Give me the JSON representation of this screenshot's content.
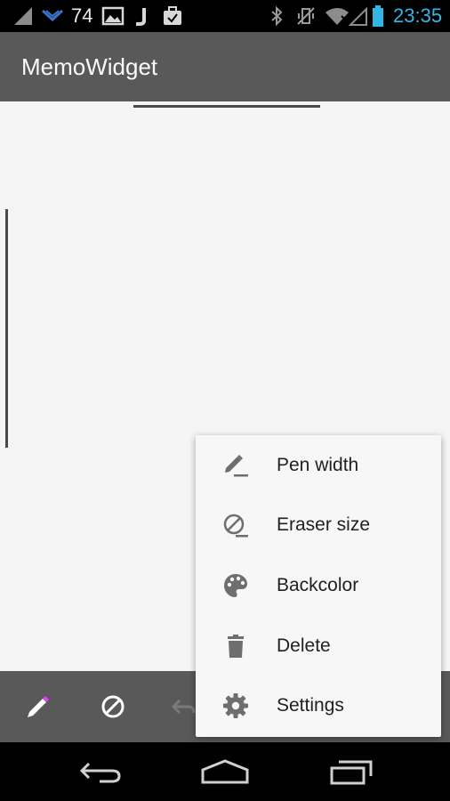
{
  "status_bar": {
    "notification_count": "74",
    "time": "23:35",
    "icons": [
      "signal-icon",
      "app-notification-icon",
      "picture-icon",
      "j-app-icon",
      "briefcase-icon",
      "bluetooth-icon",
      "vibrate-icon",
      "wifi-icon",
      "no-signal-icon",
      "battery-icon"
    ]
  },
  "app_bar": {
    "title": "MemoWidget"
  },
  "bottom_toolbar": {
    "tools": [
      "pen-icon",
      "eraser-icon",
      "undo-icon"
    ],
    "accent_color": "#e040fb"
  },
  "menu": {
    "items": [
      {
        "label": "Pen width",
        "icon": "pen-width-icon"
      },
      {
        "label": "Eraser size",
        "icon": "eraser-size-icon"
      },
      {
        "label": "Backcolor",
        "icon": "palette-icon"
      },
      {
        "label": "Delete",
        "icon": "trash-icon"
      },
      {
        "label": "Settings",
        "icon": "gear-icon"
      }
    ]
  },
  "nav_bar": {
    "buttons": [
      "back-icon",
      "home-icon",
      "recents-icon"
    ]
  },
  "colors": {
    "status_bar": "#000000",
    "app_bar": "#595959",
    "canvas": "#f5f5f5",
    "menu_bg": "#f7f7f7",
    "time": "#33b5e5"
  }
}
